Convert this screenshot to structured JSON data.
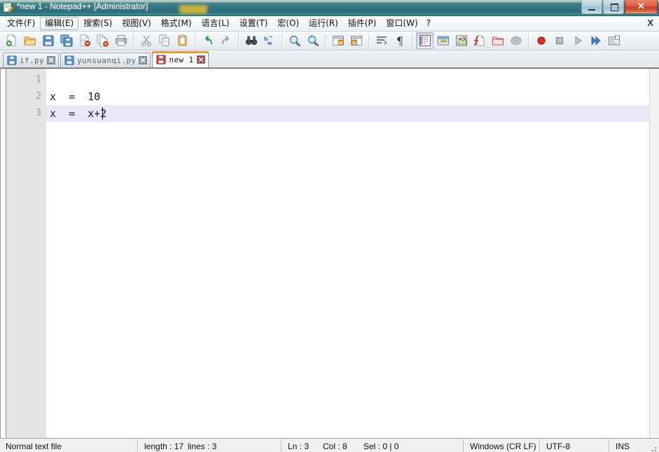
{
  "window": {
    "title": "*new 1 - Notepad++ [Administrator]",
    "icon": "notepad-plus-plus-icon",
    "minimize_label": "",
    "maximize_label": "",
    "close_label": "✕"
  },
  "menubar": {
    "items": [
      {
        "label": "文件(F)",
        "name": "menu-file",
        "hot": false
      },
      {
        "label": "编辑(E)",
        "name": "menu-edit",
        "hot": true
      },
      {
        "label": "搜索(S)",
        "name": "menu-search",
        "hot": false
      },
      {
        "label": "视图(V)",
        "name": "menu-view",
        "hot": false
      },
      {
        "label": "格式(M)",
        "name": "menu-format",
        "hot": false
      },
      {
        "label": "语言(L)",
        "name": "menu-language",
        "hot": false
      },
      {
        "label": "设置(T)",
        "name": "menu-settings",
        "hot": false
      },
      {
        "label": "宏(O)",
        "name": "menu-macro",
        "hot": false
      },
      {
        "label": "运行(R)",
        "name": "menu-run",
        "hot": false
      },
      {
        "label": "插件(P)",
        "name": "menu-plugins",
        "hot": false
      },
      {
        "label": "窗口(W)",
        "name": "menu-window",
        "hot": false
      },
      {
        "label": "?",
        "name": "menu-help",
        "hot": false
      }
    ],
    "close_document_label": "X"
  },
  "toolbar": {
    "buttons": [
      {
        "icon": "new-file-icon",
        "tooltip": "New"
      },
      {
        "icon": "open-folder-icon",
        "tooltip": "Open"
      },
      {
        "icon": "save-icon",
        "tooltip": "Save"
      },
      {
        "icon": "save-all-icon",
        "tooltip": "Save All"
      },
      {
        "icon": "close-file-icon",
        "tooltip": "Close"
      },
      {
        "icon": "close-all-icon",
        "tooltip": "Close All"
      },
      {
        "icon": "print-icon",
        "tooltip": "Print"
      },
      {
        "icon": "separator",
        "tooltip": ""
      },
      {
        "icon": "cut-scissors-icon",
        "tooltip": "Cut"
      },
      {
        "icon": "copy-icon",
        "tooltip": "Copy"
      },
      {
        "icon": "paste-clipboard-icon",
        "tooltip": "Paste"
      },
      {
        "icon": "separator",
        "tooltip": ""
      },
      {
        "icon": "undo-arrow-icon",
        "tooltip": "Undo"
      },
      {
        "icon": "redo-arrow-icon",
        "tooltip": "Redo"
      },
      {
        "icon": "separator",
        "tooltip": ""
      },
      {
        "icon": "find-binoculars-icon",
        "tooltip": "Find"
      },
      {
        "icon": "replace-icon",
        "tooltip": "Replace"
      },
      {
        "icon": "separator",
        "tooltip": ""
      },
      {
        "icon": "zoom-in-icon",
        "tooltip": "Zoom In"
      },
      {
        "icon": "zoom-out-icon",
        "tooltip": "Zoom Out"
      },
      {
        "icon": "separator",
        "tooltip": ""
      },
      {
        "icon": "sync-vertical-icon",
        "tooltip": "Synchronize Vertical Scrolling"
      },
      {
        "icon": "sync-horizontal-icon",
        "tooltip": "Synchronize Horizontal Scrolling"
      },
      {
        "icon": "separator",
        "tooltip": ""
      },
      {
        "icon": "word-wrap-icon",
        "tooltip": "Word Wrap"
      },
      {
        "icon": "pilcrow-icon",
        "tooltip": "Show All Characters"
      },
      {
        "icon": "separator",
        "tooltip": ""
      },
      {
        "icon": "indent-guide-icon",
        "tooltip": "Show Indent Guide",
        "pressed": true
      },
      {
        "icon": "user-defined-dialog-icon",
        "tooltip": "User Defined Dialogue"
      },
      {
        "icon": "document-map-icon",
        "tooltip": "Document Map"
      },
      {
        "icon": "function-list-icon",
        "tooltip": "Function List"
      },
      {
        "icon": "folder-workspace-icon",
        "tooltip": "Folder as Workspace"
      },
      {
        "icon": "monitoring-icon",
        "tooltip": "Monitoring"
      },
      {
        "icon": "separator",
        "tooltip": ""
      },
      {
        "icon": "macro-record-icon",
        "tooltip": "Start Recording"
      },
      {
        "icon": "macro-stop-icon",
        "tooltip": "Stop Recording"
      },
      {
        "icon": "macro-play-icon",
        "tooltip": "Playback"
      },
      {
        "icon": "macro-run-multi-icon",
        "tooltip": "Run a Macro Multiple Times"
      },
      {
        "icon": "macro-save-icon",
        "tooltip": "Save Current Recorded Macro"
      }
    ]
  },
  "tabs": [
    {
      "label": "if.py",
      "name": "tab-if-py",
      "active": false,
      "icon": "floppy-blue-icon",
      "close": "✖"
    },
    {
      "label": "yunsuanqi.py",
      "name": "tab-yunsuanqi-py",
      "active": false,
      "icon": "floppy-blue-icon",
      "close": "✖"
    },
    {
      "label": "new 1",
      "name": "tab-new-1",
      "active": true,
      "icon": "floppy-red-icon",
      "close": "✖"
    }
  ],
  "editor": {
    "lines": [
      {
        "num": "1",
        "text": "",
        "current": false
      },
      {
        "num": "2",
        "text": "x  =  10",
        "current": false
      },
      {
        "num": "3",
        "text": "x  =  x+2",
        "current": true
      }
    ],
    "highlight_color": "#e8e8f8",
    "gutter_color": "#e4e4e4",
    "text_color": "#1b1b2f"
  },
  "statusbar": {
    "file_type": "Normal text file",
    "length": "length : 17",
    "lines": "lines : 3",
    "ln": "Ln : 3",
    "col": "Col : 8",
    "sel": "Sel : 0 | 0",
    "eol": "Windows (CR LF)",
    "encoding": "UTF-8",
    "insert_mode": "INS"
  }
}
